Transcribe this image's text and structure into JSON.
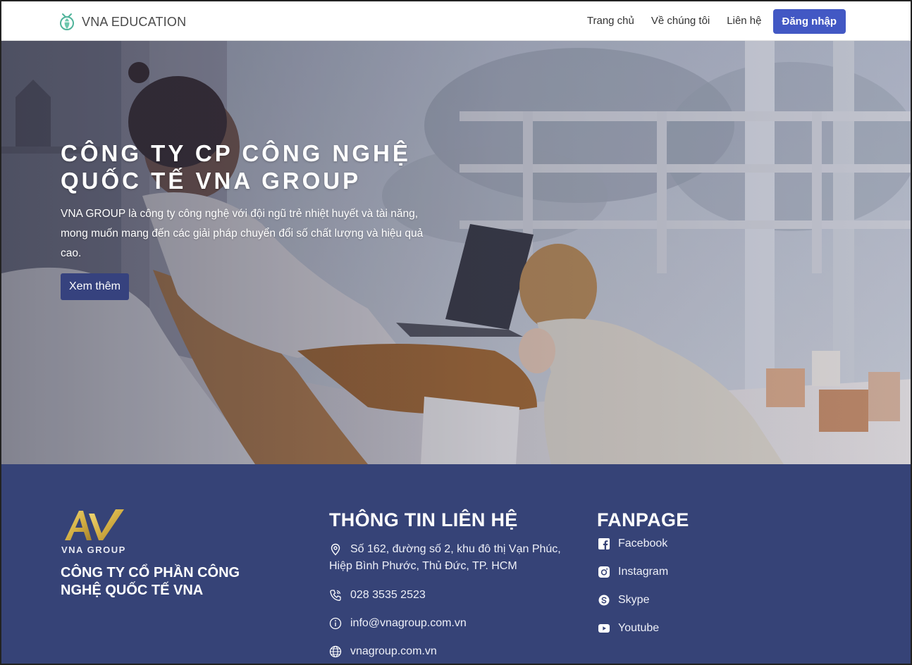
{
  "navbar": {
    "brand": "VNA EDUCATION",
    "links": [
      "Trang chủ",
      "Về chúng tôi",
      "Liên hệ"
    ],
    "login_label": "Đăng nhập"
  },
  "hero": {
    "title_line1": "CÔNG TY CP CÔNG NGHỆ",
    "title_line2": "QUỐC TẾ VNA GROUP",
    "description": "VNA GROUP là công ty công nghệ với đội ngũ trẻ nhiệt huyết và tài năng, mong muốn mang đến các giải pháp chuyển đổi số chất lượng và hiệu quả cao.",
    "button_label": "Xem thêm"
  },
  "footer": {
    "logo_caption": "VNA GROUP",
    "company_name": "CÔNG TY CỔ PHẦN CÔNG NGHỆ QUỐC TẾ VNA",
    "contact": {
      "heading": "THÔNG TIN LIÊN HỆ",
      "address_line1": "Số 162, đường số 2, khu đô thị Vạn Phúc,",
      "address_line2": "Hiệp Bình Phước, Thủ Đức, TP. HCM",
      "phone": "028 3535 2523",
      "email": "info@vnagroup.com.vn",
      "website": "vnagroup.com.vn"
    },
    "fanpage": {
      "heading": "FANPAGE",
      "items": [
        "Facebook",
        "Instagram",
        "Skype",
        "Youtube"
      ]
    }
  },
  "colors": {
    "primary_button": "#4258c4",
    "hero_button": "#36427e",
    "footer_bg": "#364377",
    "logo_gold": "#d4b045"
  },
  "icons": [
    "leaf-logo-icon",
    "location-icon",
    "phone-icon",
    "info-icon",
    "globe-icon",
    "facebook-icon",
    "instagram-icon",
    "skype-icon",
    "youtube-icon"
  ]
}
